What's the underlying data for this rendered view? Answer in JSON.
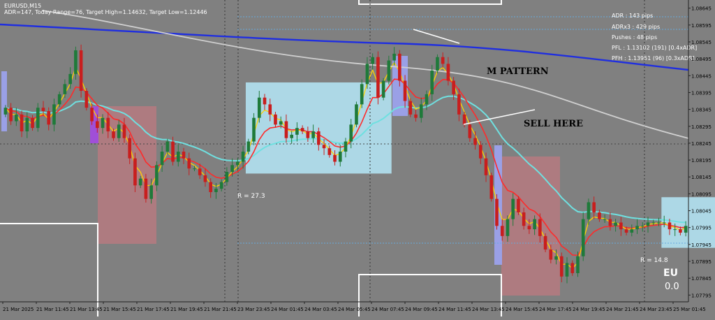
{
  "window": {
    "title": "EURUSD,M15",
    "info_line": "ADR=147, Today Range=76, Target High=1.14632, Target Low=1.12446"
  },
  "hud": {
    "lines": [
      "ADR : 143 pips",
      "ADRx3 : 429 pips",
      "Pushes : 48 pips",
      "PFL : 1.13102 (191) [0.4xADR]",
      "PFH : 1.13951 (96) [0.3xADR]"
    ]
  },
  "annotations": {
    "m_pattern": "M PATTERN",
    "sell_here": "SELL HERE",
    "range_box_1": "R = 27.3",
    "range_box_2": "R = 14.8",
    "symbol_short": "EU",
    "symbol_value": "0.0"
  },
  "colors": {
    "background": "#808080",
    "bull_candle": "#1f7a3a",
    "bear_candle": "#c81e1e",
    "ma_fast": "#ffd400",
    "ma_red": "#ff2a2a",
    "ma_cyan": "#6fe0e0",
    "ma_blue": "#1f2ee0",
    "ma_grey": "#d0d0d0",
    "range_box": "#add8e6",
    "pink_zone": "#b37a80",
    "purple_bar": "#a04fd8"
  },
  "chart_data": {
    "type": "candlestick",
    "symbol": "EURUSD",
    "timeframe": "M15",
    "y_axis": {
      "ticks": [
        "1.08645",
        "1.08595",
        "1.08545",
        "1.08495",
        "1.08445",
        "1.08395",
        "1.08345",
        "1.08295",
        "1.08245",
        "1.08195",
        "1.08145",
        "1.08095",
        "1.08045",
        "1.07995",
        "1.07945",
        "1.07895",
        "1.07845",
        "1.07795"
      ],
      "ylim": [
        1.07775,
        1.08665
      ]
    },
    "x_axis": {
      "ticks": [
        "21 Mar 2025",
        "21 Mar 11:45",
        "21 Mar 13:45",
        "21 Mar 15:45",
        "21 Mar 17:45",
        "21 Mar 19:45",
        "21 Mar 21:45",
        "23 Mar 23:45",
        "24 Mar 01:45",
        "24 Mar 03:45",
        "24 Mar 05:45",
        "24 Mar 07:45",
        "24 Mar 09:45",
        "24 Mar 11:45",
        "24 Mar 13:45",
        "24 Mar 15:45",
        "24 Mar 17:45",
        "24 Mar 19:45",
        "24 Mar 21:45",
        "24 Mar 23:45",
        "25 Mar 01:45"
      ]
    },
    "candles_close": [
      1.0835,
      1.0831,
      1.0833,
      1.0828,
      1.0832,
      1.0829,
      1.0835,
      1.0834,
      1.083,
      1.0836,
      1.0839,
      1.0842,
      1.0845,
      1.0852,
      1.084,
      1.0835,
      1.0831,
      1.0829,
      1.0832,
      1.0828,
      1.0826,
      1.083,
      1.0826,
      1.082,
      1.0812,
      1.0814,
      1.0808,
      1.0812,
      1.0818,
      1.0822,
      1.0825,
      1.0819,
      1.0822,
      1.082,
      1.0817,
      1.0817,
      1.0815,
      1.0813,
      1.081,
      1.0811,
      1.0813,
      1.0816,
      1.0818,
      1.0819,
      1.0822,
      1.0825,
      1.0832,
      1.0838,
      1.0836,
      1.0833,
      1.083,
      1.0831,
      1.0826,
      1.0827,
      1.0829,
      1.0828,
      1.0826,
      1.0828,
      1.0824,
      1.0823,
      1.0821,
      1.0819,
      1.0822,
      1.0825,
      1.083,
      1.0836,
      1.0842,
      1.0848,
      1.085,
      1.0838,
      1.0843,
      1.0849,
      1.0851,
      1.0843,
      1.0837,
      1.0833,
      1.0832,
      1.0836,
      1.0839,
      1.0846,
      1.085,
      1.0848,
      1.0843,
      1.0839,
      1.0833,
      1.083,
      1.0826,
      1.0824,
      1.082,
      1.0815,
      1.0808,
      1.08,
      1.0797,
      1.0802,
      1.0808,
      1.0804,
      1.08,
      1.0799,
      1.0802,
      1.0797,
      1.0793,
      1.079,
      1.0791,
      1.0785,
      1.0789,
      1.0786,
      1.0791,
      1.0802,
      1.0807,
      1.0804,
      1.0802,
      1.0802,
      1.08,
      1.0801,
      1.0799,
      1.0798,
      1.0799,
      1.08,
      1.08,
      1.0801,
      1.0801,
      1.0801,
      1.0801,
      1.0799,
      1.0799,
      1.0798,
      1.08
    ],
    "range_boxes": [
      {
        "label": "R = 27.3",
        "from_index": 45,
        "to_index": 71,
        "top": 1.08425,
        "bottom": 1.08155
      },
      {
        "label": "R = 14.8",
        "from_index": 122,
        "to_index": 131,
        "top": 1.08085,
        "bottom": 1.07935
      }
    ],
    "grid": false
  }
}
